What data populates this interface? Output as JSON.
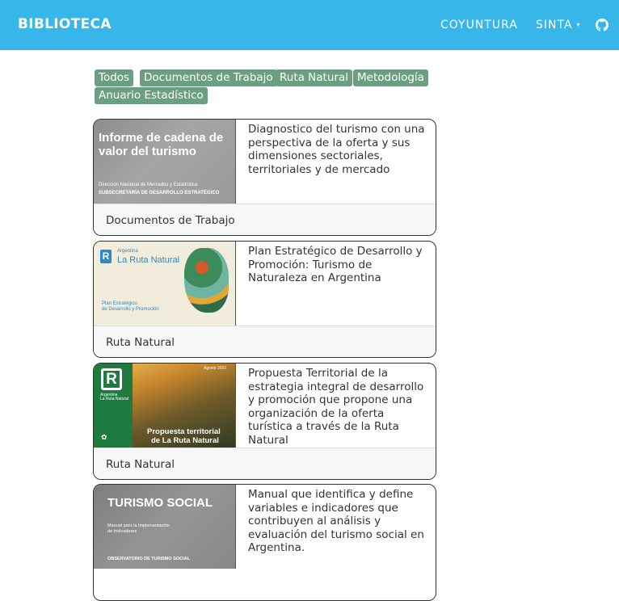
{
  "header": {
    "brand": "BIBLIOTECA",
    "nav": [
      {
        "label": "COYUNTURA"
      },
      {
        "label": "SINTA",
        "caret": "▾"
      }
    ],
    "github_icon": "github-icon"
  },
  "filters": [
    "Todos",
    "Documentos de Trabajo",
    "Ruta Natural",
    "Metodología",
    "Anuario Estadístico"
  ],
  "colors": {
    "topbar": "#37b6e9",
    "tag": "#6c9e81",
    "card_footer": "#f7f7f7"
  },
  "cards": [
    {
      "thumb_title": "Informe de cadena de valor del turismo",
      "thumb_sub1": "Dirección Nacional de Mercados y Estadística",
      "thumb_sub2": "SUBSECRETARÍA DE DESARROLLO ESTRATÉGICO",
      "description": "Diagnostico del turismo con una perspectiva de la oferta y sus dimensiones sectoriales, territoriales y de mercado",
      "category": "Documentos de Trabajo"
    },
    {
      "thumb_brand1": "Argentina",
      "thumb_brand2": "La Ruta Natural",
      "thumb_sub1": "Plan Estratégico",
      "thumb_sub2": "de Desarrollo y Promoción",
      "description": "Plan Estratégico de Desarrollo y Promoción: Turismo de Naturaleza en Argentina",
      "category": "Ruta Natural"
    },
    {
      "thumb_date": "Agosto 2022",
      "thumb_brand1": "Argentina",
      "thumb_brand2": "La Ruta Natural",
      "thumb_title1": "Propuesta territorial",
      "thumb_title2": "de La Ruta Natural",
      "description": "Propuesta Territorial de la estrategia integral de desarrollo y promoción que propone una organización de la oferta turística a través de la Ruta Natural",
      "category": "Ruta Natural"
    },
    {
      "thumb_title": "TURISMO SOCIAL",
      "thumb_sub1": "Manual para la Implementación",
      "thumb_sub2": "de Indicadores",
      "thumb_sub3": "OBSERVATORIO DE TURISMO SOCIAL",
      "description": "Manual que identifica y define variables e indicadores que contribuyen al análisis y evaluación del turismo social en Argentina."
    }
  ]
}
